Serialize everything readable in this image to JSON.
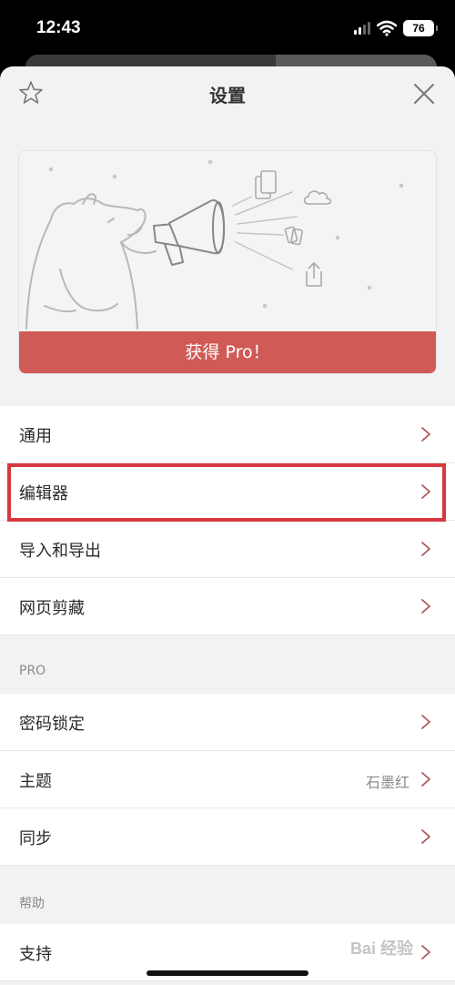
{
  "status_bar": {
    "time": "12:43",
    "battery": "76"
  },
  "header": {
    "title": "设置"
  },
  "promo": {
    "button_label": "获得 Pro！"
  },
  "sections": {
    "general": [
      {
        "label": "通用"
      },
      {
        "label": "编辑器"
      },
      {
        "label": "导入和导出"
      },
      {
        "label": "网页剪藏"
      }
    ],
    "pro": {
      "header": "PRO",
      "items": [
        {
          "label": "密码锁定"
        },
        {
          "label": "主题",
          "value": "石墨红"
        },
        {
          "label": "同步"
        }
      ]
    },
    "help": {
      "header": "帮助",
      "items": [
        {
          "label": "支持"
        }
      ]
    }
  },
  "watermark": "Bai 经验",
  "colors": {
    "accent": "#d05a56",
    "highlight": "#d6383e",
    "chevron": "#b0575a"
  }
}
